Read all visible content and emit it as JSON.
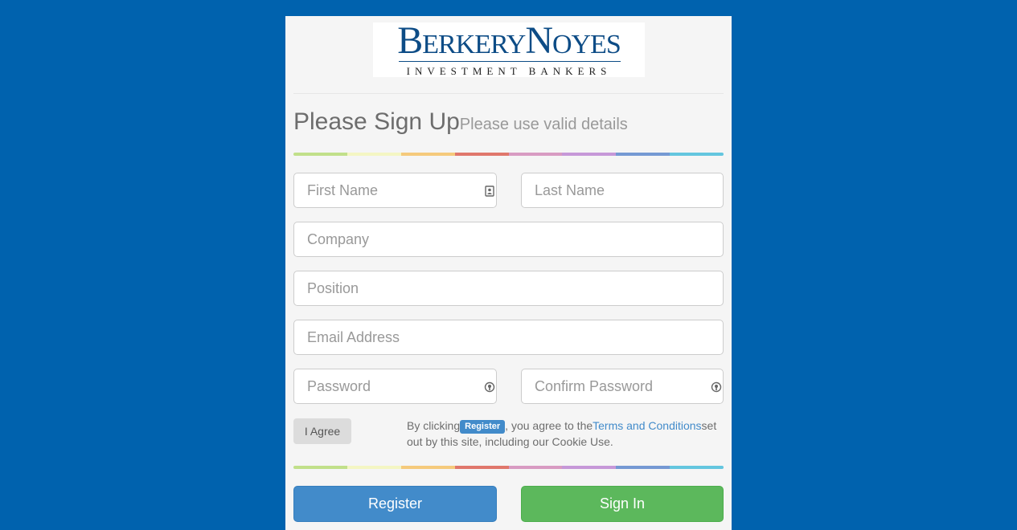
{
  "logo": {
    "name_part1_cap": "B",
    "name_part1_rest": "ERKERY",
    "name_part2_cap": "N",
    "name_part2_rest": "OYES",
    "tagline": "INVESTMENT BANKERS",
    "color": "#0d4c86"
  },
  "form": {
    "title": "Please Sign Up",
    "subtitle": "Please use valid details",
    "rainbow_colors": [
      "#c1e08a",
      "#f4f6c3",
      "#f5ca7c",
      "#e0776c",
      "#d89bc2",
      "#c698d8",
      "#7599d3",
      "#64c6df"
    ],
    "fields": {
      "first_name": {
        "placeholder": "First Name",
        "value": ""
      },
      "last_name": {
        "placeholder": "Last Name",
        "value": ""
      },
      "company": {
        "placeholder": "Company",
        "value": ""
      },
      "position": {
        "placeholder": "Position",
        "value": ""
      },
      "email": {
        "placeholder": "Email Address",
        "value": ""
      },
      "password": {
        "placeholder": "Password",
        "value": ""
      },
      "confirm_password": {
        "placeholder": "Confirm Password",
        "value": ""
      }
    },
    "icons": {
      "first_name": "contact-card-icon",
      "password": "lock-icon",
      "confirm_password": "lock-icon"
    },
    "agree_label": "I Agree",
    "terms": {
      "prefix": "By clicking",
      "badge": "Register",
      "middle": ", you agree to the",
      "link": "Terms and Conditions",
      "suffix": "set out by this site, including our Cookie Use."
    },
    "register_label": "Register",
    "signin_label": "Sign In"
  },
  "colors": {
    "page_background": "#0062ae",
    "card_background": "#f5f5f5",
    "primary": "#428bca",
    "success": "#5cb85c"
  }
}
